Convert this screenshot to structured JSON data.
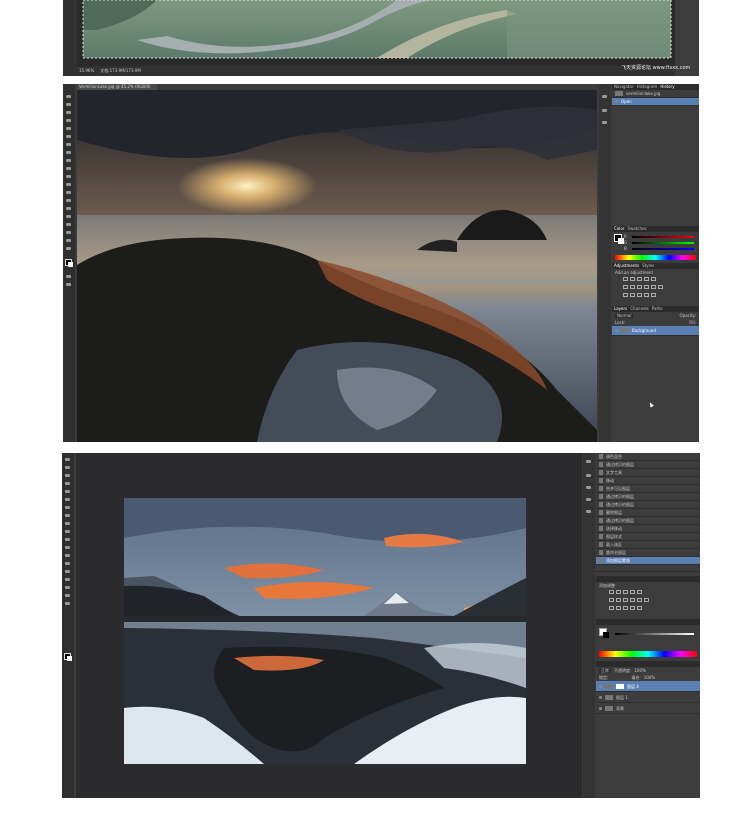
{
  "shot1": {
    "status": {
      "zoom": "15.96%",
      "doc": "文档:173.9M/173.9M"
    },
    "watermark": "飞天资源论坛 www.ftsxx.com"
  },
  "shot2": {
    "doc_tab": "VermilionLake.jpg @ 45.2% (RGB/8)",
    "nav_tabs": [
      "Navigator",
      "Histogram",
      "History"
    ],
    "history": {
      "file": "vermilionlake.jpg",
      "first": "Open"
    },
    "color_tabs": [
      "Color",
      "Swatches"
    ],
    "color_rows": [
      "R",
      "G",
      "B"
    ],
    "adjust_tabs": [
      "Adjustments",
      "Styles"
    ],
    "adjust_title": "Add an adjustment",
    "layers_tabs": [
      "Layers",
      "Channels",
      "Paths"
    ],
    "blend": "Normal",
    "opacity_label": "Opacity:",
    "lock_label": "Lock:",
    "fill_label": "Fill:",
    "layer": "Background"
  },
  "shot3": {
    "history": [
      "调色混合",
      "通过拷贝的图层",
      "文字工具",
      "移动",
      "合并可见图层",
      "通过拷贝的图层",
      "通过拷贝的图层",
      "删除图层",
      "通过拷贝的图层",
      "选择移动",
      "图层样式",
      "载入选区",
      "重命名图层",
      "添加图层蒙版"
    ],
    "adjust_title": "添加调整",
    "layers_mode": "正常",
    "opacity_label": "不透明度:",
    "opacity": "100%",
    "fill_label": "填充:",
    "fill": "100%",
    "lock_label": "锁定:",
    "layers": [
      "图层 4",
      "图层 1",
      "背景"
    ]
  }
}
